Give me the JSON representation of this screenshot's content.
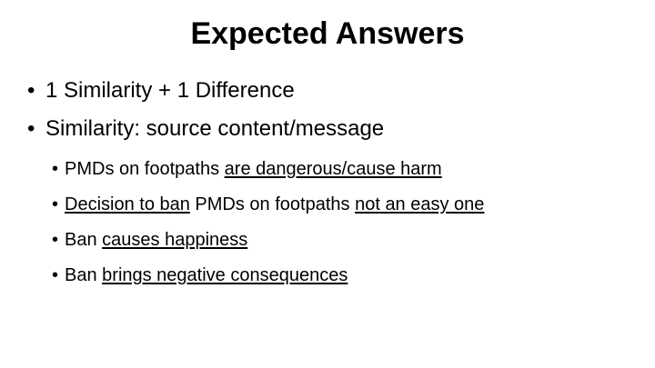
{
  "slide": {
    "title": "Expected Answers",
    "bullets": [
      {
        "text": "1 Similarity + 1 Difference"
      },
      {
        "text": "Similarity: source content/message"
      }
    ],
    "sub_bullets": [
      {
        "parts": [
          "PMDs on footpaths ",
          "are dangerous/cause harm"
        ]
      },
      {
        "parts": [
          "Decision to ban",
          " PMDs on footpaths ",
          "not an easy one"
        ]
      },
      {
        "parts": [
          "Ban ",
          "causes happiness"
        ]
      },
      {
        "parts": [
          "Ban ",
          "brings negative consequences"
        ]
      }
    ]
  }
}
